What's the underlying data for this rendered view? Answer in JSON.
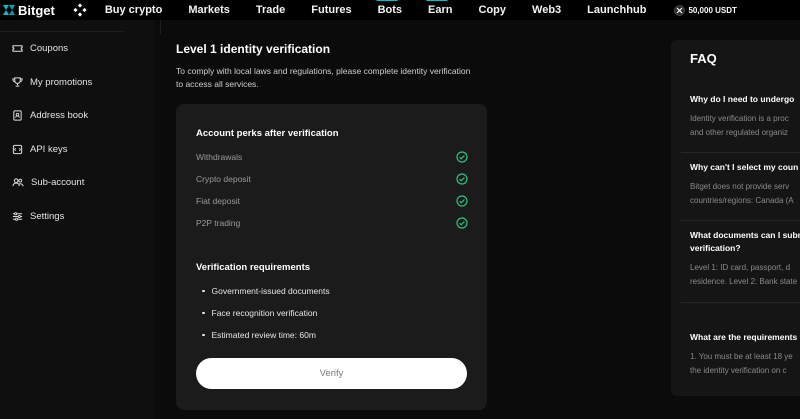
{
  "brand": {
    "name": "Bitget"
  },
  "nav": {
    "items": [
      "Buy crypto",
      "Markets",
      "Trade",
      "Futures",
      "Bots",
      "Earn",
      "Copy",
      "Web3",
      "Launchhub"
    ],
    "promo": "50,000 USDT"
  },
  "sidebar": {
    "items": [
      {
        "label": "Coupons",
        "icon": "coupon-icon"
      },
      {
        "label": "My promotions",
        "icon": "trophy-icon"
      },
      {
        "label": "Address book",
        "icon": "address-book-icon"
      },
      {
        "label": "API keys",
        "icon": "api-icon"
      },
      {
        "label": "Sub-account",
        "icon": "users-icon"
      },
      {
        "label": "Settings",
        "icon": "settings-sliders-icon"
      }
    ]
  },
  "main": {
    "title": "Level 1 identity verification",
    "description": "To comply with local laws and regulations, please complete identity verification to access all services.",
    "perks_title": "Account perks after verification",
    "perks": [
      "Withdrawals",
      "Crypto deposit",
      "Fiat deposit",
      "P2P trading"
    ],
    "requirements_title": "Verification requirements",
    "requirements": [
      "Government-issued documents",
      "Face recognition verification",
      "Estimated review time: 60m"
    ],
    "verify_label": "Verify"
  },
  "faq": {
    "title": "FAQ",
    "items": [
      {
        "q": "Why do I need to undergo",
        "a1": "Identity verification is a proc",
        "a2": "and other regulated organiz"
      },
      {
        "q": "Why can't I select my coun",
        "a1": "Bitget does not provide serv",
        "a2": "countries/regions: Canada (A"
      },
      {
        "q": "What documents can I subm",
        "q2": "verification?",
        "a1": "Level 1: ID card, passport, d",
        "a2": "residence. Level 2: Bank state"
      },
      {
        "q": "What are the requirements",
        "a1": "1. You must be at least 18 ye",
        "a2": "the identity verification on c"
      }
    ]
  },
  "colors": {
    "accent": "#00c2c8",
    "check": "#2ec27e",
    "button": "#ffffff"
  }
}
